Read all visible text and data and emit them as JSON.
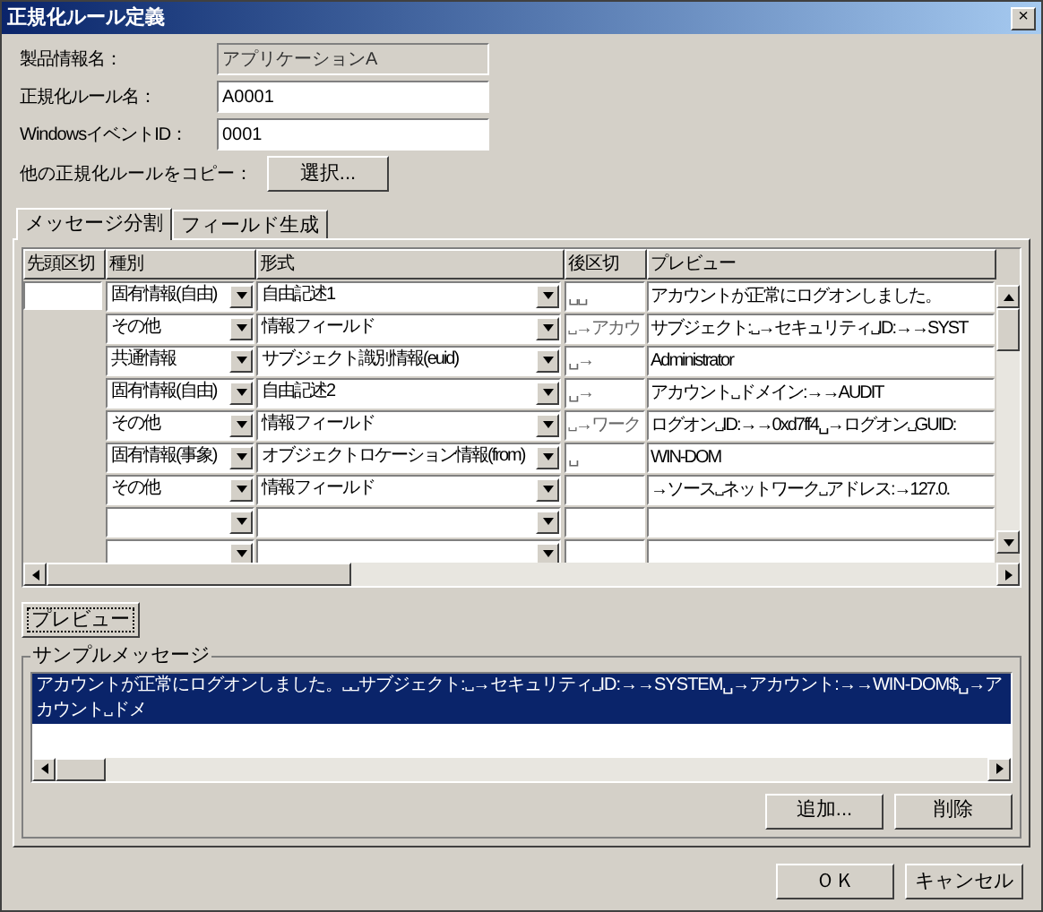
{
  "window": {
    "title": "正規化ルール定義",
    "close": "×"
  },
  "fields": [
    {
      "label": "製品情報名：",
      "value": "アプリケーションA",
      "disabled": true
    },
    {
      "label": "正規化ルール名：",
      "value": "A0001",
      "disabled": false
    },
    {
      "label": "WindowsイベントID：",
      "value": "0001",
      "disabled": false
    }
  ],
  "copy": {
    "label": "他の正規化ルールをコピー：",
    "button": "選択..."
  },
  "tabs": [
    {
      "label": "メッセージ分割",
      "selected": true
    },
    {
      "label": "フィールド生成",
      "selected": false
    }
  ],
  "table": {
    "columns": [
      "先頭区切",
      "種別",
      "形式",
      "後区切",
      "プレビュー"
    ],
    "rows": [
      {
        "lead_field": true,
        "kind": "固有情報(自由)",
        "format": "自由記述1",
        "after": "␣␣",
        "preview": "アカウントが正常にログオンしました。"
      },
      {
        "lead_field": false,
        "kind": "その他",
        "format": "情報フィールド",
        "after": "␣→アカウ",
        "preview": "サブジェクト:␣→セキュリティ␣ID:→→SYST"
      },
      {
        "lead_field": false,
        "kind": "共通情報",
        "format": "サブジェクト識別情報(euid)",
        "after": "␣→",
        "preview": "Administrator"
      },
      {
        "lead_field": false,
        "kind": "固有情報(自由)",
        "format": "自由記述2",
        "after": "␣→",
        "preview": "アカウント␣ドメイン:→→AUDIT"
      },
      {
        "lead_field": false,
        "kind": "その他",
        "format": "情報フィールド",
        "after": "␣→ワーク",
        "preview": "ログオン␣ID:→→0xd7ff4␣→ログオン␣GUID:"
      },
      {
        "lead_field": false,
        "kind": "固有情報(事象)",
        "format": "オブジェクトロケーション情報(from)",
        "after": "␣",
        "preview": "WIN-DOM"
      },
      {
        "lead_field": false,
        "kind": "その他",
        "format": "情報フィールド",
        "preview": "→ソース␣ネットワーク␣アドレス:→127.0."
      },
      {
        "lead_field": false
      },
      {
        "lead_field": false
      }
    ]
  },
  "preview_button": "プレビュー",
  "sample": {
    "title": "サンプルメッセージ",
    "items": [
      {
        "text": "アカウントが正常にログオンしました。␣␣サブジェクト:␣→セキュリティ␣ID:→→SYSTEM␣→アカウント:→→WIN-DOM$␣→アカウント␣ドメ",
        "selected": true
      }
    ],
    "buttons": [
      "追加...",
      "削除"
    ]
  },
  "buttons": [
    "ＯＫ",
    "キャンセル"
  ]
}
